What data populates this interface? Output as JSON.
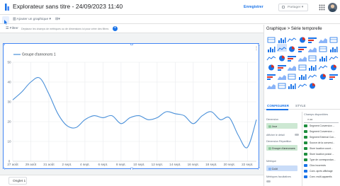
{
  "header": {
    "title": "Explorateur sans titre - 24/09/2023 11:40",
    "save_label": "Enregistrer",
    "share_label": "Partager"
  },
  "toolbar": {
    "add_chart_label": "Ajouter un graphique",
    "add_control_label": "▾"
  },
  "filterbar": {
    "label": "Filtrer",
    "hint": "Déplacez les champs de métriques ou de dimensions ici pour créer des filtres"
  },
  "pages": [
    {
      "label": "Onglet 1"
    }
  ],
  "panel": {
    "breadcrumb_root": "Graphique",
    "breadcrumb_sep": ">",
    "breadcrumb_current": "Série temporelle",
    "tabs": {
      "config": "CONFIGURER",
      "style": "STYLE"
    },
    "config": {
      "dimension_header": "Dimension",
      "dimension_value": "Jour",
      "drilldown_label": "Afficher le détail",
      "breakdown_header": "Dimension Répartition",
      "breakdown_value": "Groupe d'annonces",
      "metric_header": "Métrique",
      "metric_value": "Coût",
      "optional_header": "Métriques facultatives"
    },
    "fields": {
      "title": "Champs disponibles",
      "search_value": "co",
      "items": [
        {
          "label": "Segment Conversion ...",
          "kind": "dim"
        },
        {
          "label": "Segment Conversion ...",
          "kind": "dim"
        },
        {
          "label": "Segment External Con...",
          "kind": "dim"
        },
        {
          "label": "Source de la conversi...",
          "kind": "dim"
        },
        {
          "label": "Store location count...",
          "kind": "dim"
        },
        {
          "label": "Store location postal ...",
          "kind": "dim"
        },
        {
          "label": "Type de correspondan...",
          "kind": "dim"
        },
        {
          "label": "Clics incorrects",
          "kind": "met"
        },
        {
          "label": "Conv. après affichage",
          "kind": "met"
        },
        {
          "label": "Conv. multi-appareils",
          "kind": "met"
        }
      ]
    }
  },
  "colors": {
    "accent": "#1a73e8",
    "line": "#4a90d9",
    "dimension": "#1e8e3e",
    "metric": "#1a73e8"
  },
  "chart_data": {
    "type": "line",
    "legend": [
      "Groupe d'annonces 1"
    ],
    "x_ticks": [
      "27 août",
      "29 août",
      "31 août",
      "2 sept.",
      "4 sept.",
      "6 sept.",
      "8 sept.",
      "10 sept.",
      "12 sept.",
      "14 sept.",
      "16 sept.",
      "18 sept.",
      "20 sept.",
      "22 sept."
    ],
    "y_ticks": [
      "0",
      "10",
      "20",
      "30",
      "40",
      "50"
    ],
    "ylim": [
      0,
      50
    ],
    "xlim": [
      0,
      27
    ],
    "series": [
      {
        "name": "Groupe d'annonces 1",
        "x": [
          0,
          1,
          2,
          3,
          4,
          5,
          6,
          7,
          8,
          9,
          10,
          11,
          12,
          13,
          14,
          15,
          16,
          17,
          18,
          19,
          20,
          21,
          22,
          23,
          24,
          25,
          26,
          27
        ],
        "values": [
          31,
          35,
          40,
          42,
          34,
          24,
          18,
          17,
          21,
          23,
          22,
          23,
          19,
          22,
          23,
          21,
          22,
          25,
          24,
          23,
          19,
          23,
          25,
          21,
          22,
          13,
          7,
          21
        ]
      }
    ]
  }
}
